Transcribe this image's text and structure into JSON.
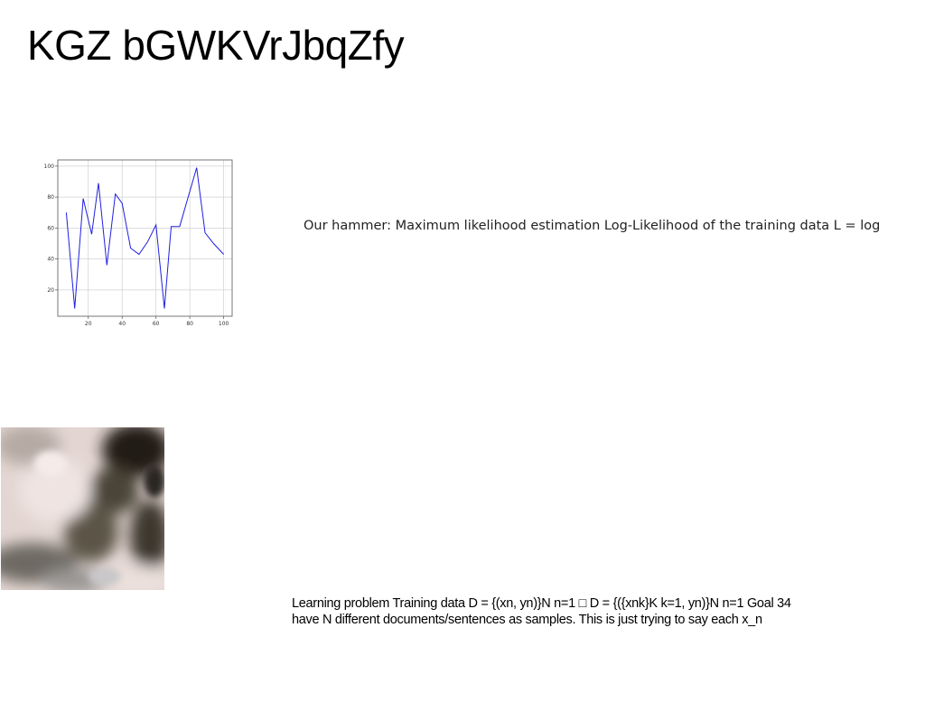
{
  "slide": {
    "title": "KGZ bGWKVrJbqZfy",
    "text_block_1": "Our hammer: Maximum likelihood estimation Log-Likelihood of the training data L = log",
    "text_block_2": {
      "line1": "Learning problem Training data D = {(xn, yn)}N n=1 □ D = {({xnk}K k=1, yn)}N n=1 Goal 34",
      "line2": "have N different documents/sentences as samples. This is just trying to say each x_n"
    }
  },
  "chart_data": {
    "type": "line",
    "x": [
      7,
      12,
      17,
      22,
      26,
      31,
      36,
      40,
      45,
      50,
      55,
      60,
      65,
      69,
      74,
      79,
      84,
      89,
      94,
      100
    ],
    "series": [
      {
        "color": "#1f1fe0",
        "values": [
          70,
          8,
          79,
          56,
          89,
          36,
          82,
          76,
          47,
          43,
          51,
          62,
          8,
          61,
          61,
          80,
          99,
          57,
          50,
          43
        ]
      }
    ],
    "xticks": [
      20,
      40,
      60,
      80,
      100
    ],
    "yticks": [
      20,
      40,
      60,
      80,
      100
    ],
    "xlim": [
      2,
      105
    ],
    "ylim": [
      3,
      104
    ],
    "grid": true,
    "title": "",
    "xlabel": "",
    "ylabel": ""
  }
}
